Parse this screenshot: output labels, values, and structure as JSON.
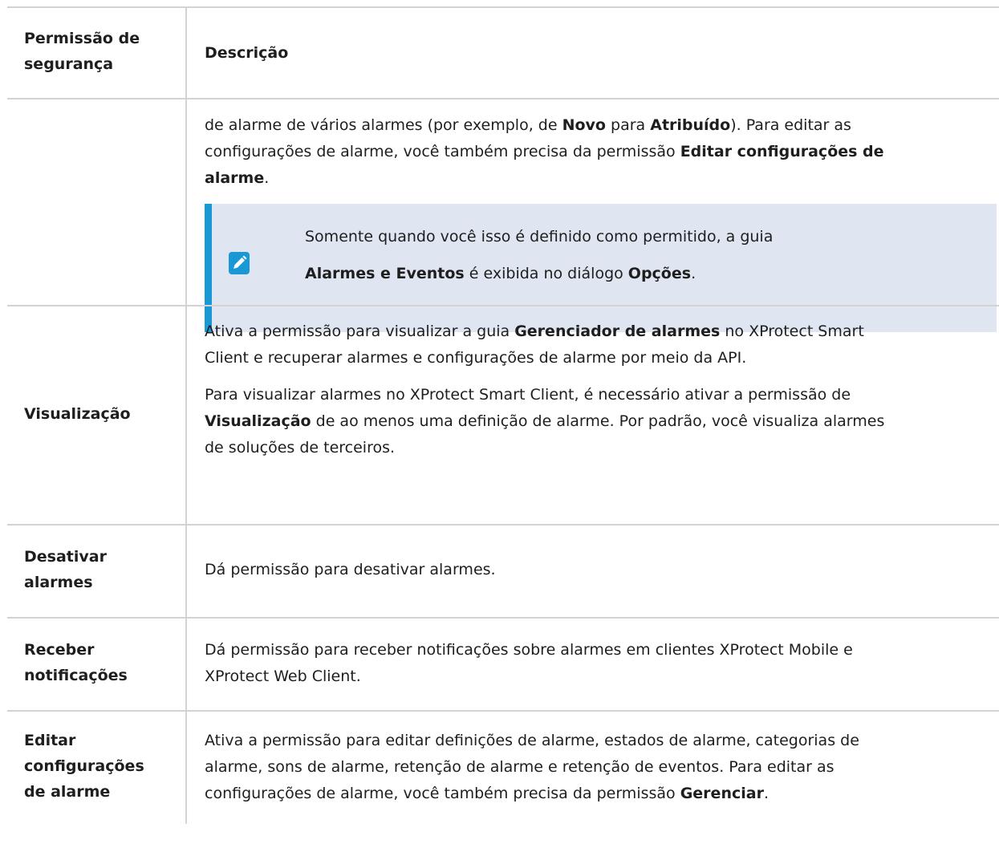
{
  "table": {
    "header": {
      "col1": [
        "Permissão de",
        "segurança"
      ],
      "col2": "Descrição"
    },
    "rows": [
      {
        "permission": [],
        "description": [
          [
            {
              "t": "de alarme de vários alarmes (por exemplo, de "
            },
            {
              "t": "Novo",
              "b": true
            },
            {
              "t": " para "
            },
            {
              "t": "Atribuído",
              "b": true
            },
            {
              "t": "). Para editar as"
            }
          ],
          [
            {
              "t": "configurações de alarme, você também precisa da permissão "
            },
            {
              "t": "Editar configurações de",
              "b": true
            }
          ],
          [
            {
              "t": "alarme",
              "b": true
            },
            {
              "t": "."
            }
          ]
        ],
        "note": {
          "icon": "pencil-icon",
          "lines": [
            [
              {
                "t": "Somente quando você isso é definido como permitido, a guia"
              }
            ],
            [
              {
                "t": "Alarmes e Eventos",
                "b": true
              },
              {
                "t": " é exibida no diálogo "
              },
              {
                "t": "Opções",
                "b": true
              },
              {
                "t": "."
              }
            ]
          ]
        }
      },
      {
        "permission": [
          "Visualização"
        ],
        "description": [
          [
            {
              "t": "Ativa a permissão para visualizar a guia "
            },
            {
              "t": "Gerenciador de alarmes",
              "b": true
            },
            {
              "t": " no XProtect Smart"
            }
          ],
          [
            {
              "t": "Client e recuperar alarmes e configurações de alarme por meio da API."
            }
          ],
          [
            {
              "t": "Para visualizar alarmes no XProtect Smart Client, é necessário ativar a permissão de"
            }
          ],
          [
            {
              "t": "Visualização",
              "b": true
            },
            {
              "t": " de ao menos uma definição de alarme. Por padrão, você visualiza alarmes"
            }
          ],
          [
            {
              "t": "de soluções de terceiros."
            }
          ]
        ]
      },
      {
        "permission": [
          "Desativar",
          "alarmes"
        ],
        "description": [
          [
            {
              "t": "Dá permissão para desativar alarmes."
            }
          ]
        ]
      },
      {
        "permission": [
          "Receber",
          "notificações"
        ],
        "description": [
          [
            {
              "t": "Dá permissão para receber notificações sobre alarmes em clientes XProtect Mobile e"
            }
          ],
          [
            {
              "t": "XProtect Web Client."
            }
          ]
        ]
      },
      {
        "permission": [
          "Editar",
          "configurações",
          "de alarme"
        ],
        "description": [
          [
            {
              "t": "Ativa a permissão para editar definições de alarme, estados de alarme, categorias de"
            }
          ],
          [
            {
              "t": "alarme, sons de alarme, retenção de alarme e retenção de eventos. Para editar as"
            }
          ],
          [
            {
              "t": "configurações de alarme, você também precisa da permissão "
            },
            {
              "t": "Gerenciar",
              "b": true
            },
            {
              "t": "."
            }
          ]
        ]
      }
    ]
  },
  "colors": {
    "note_bg": "#dfe6f1",
    "note_bar": "#1a97d5",
    "border": "#d3d3d3"
  }
}
